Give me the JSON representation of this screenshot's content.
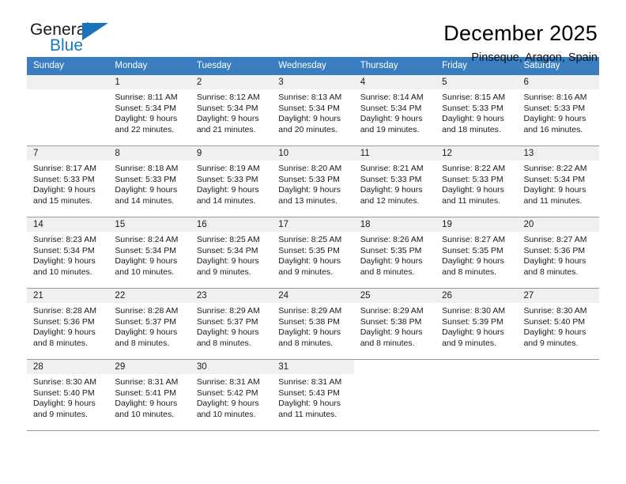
{
  "brand": {
    "name_part1": "General",
    "name_part2": "Blue",
    "triangle_color": "#1b74bb"
  },
  "header": {
    "title": "December 2025",
    "location": "Pinseque, Aragon, Spain"
  },
  "theme": {
    "header_row_bg": "#3a7ebf",
    "day_band_bg": "#f0f0f0",
    "grid_line": "#9a9a9a",
    "brand_blue": "#1878be"
  },
  "weekday_headers": [
    "Sunday",
    "Monday",
    "Tuesday",
    "Wednesday",
    "Thursday",
    "Friday",
    "Saturday"
  ],
  "labels": {
    "sunrise_prefix": "Sunrise:",
    "sunset_prefix": "Sunset:",
    "daylight_prefix": "Daylight:"
  },
  "weeks": [
    [
      {
        "day": "",
        "sunrise": "",
        "sunset": "",
        "daylight_line1": "",
        "daylight_line2": ""
      },
      {
        "day": "1",
        "sunrise": "Sunrise: 8:11 AM",
        "sunset": "Sunset: 5:34 PM",
        "daylight_line1": "Daylight: 9 hours",
        "daylight_line2": "and 22 minutes."
      },
      {
        "day": "2",
        "sunrise": "Sunrise: 8:12 AM",
        "sunset": "Sunset: 5:34 PM",
        "daylight_line1": "Daylight: 9 hours",
        "daylight_line2": "and 21 minutes."
      },
      {
        "day": "3",
        "sunrise": "Sunrise: 8:13 AM",
        "sunset": "Sunset: 5:34 PM",
        "daylight_line1": "Daylight: 9 hours",
        "daylight_line2": "and 20 minutes."
      },
      {
        "day": "4",
        "sunrise": "Sunrise: 8:14 AM",
        "sunset": "Sunset: 5:34 PM",
        "daylight_line1": "Daylight: 9 hours",
        "daylight_line2": "and 19 minutes."
      },
      {
        "day": "5",
        "sunrise": "Sunrise: 8:15 AM",
        "sunset": "Sunset: 5:33 PM",
        "daylight_line1": "Daylight: 9 hours",
        "daylight_line2": "and 18 minutes."
      },
      {
        "day": "6",
        "sunrise": "Sunrise: 8:16 AM",
        "sunset": "Sunset: 5:33 PM",
        "daylight_line1": "Daylight: 9 hours",
        "daylight_line2": "and 16 minutes."
      }
    ],
    [
      {
        "day": "7",
        "sunrise": "Sunrise: 8:17 AM",
        "sunset": "Sunset: 5:33 PM",
        "daylight_line1": "Daylight: 9 hours",
        "daylight_line2": "and 15 minutes."
      },
      {
        "day": "8",
        "sunrise": "Sunrise: 8:18 AM",
        "sunset": "Sunset: 5:33 PM",
        "daylight_line1": "Daylight: 9 hours",
        "daylight_line2": "and 14 minutes."
      },
      {
        "day": "9",
        "sunrise": "Sunrise: 8:19 AM",
        "sunset": "Sunset: 5:33 PM",
        "daylight_line1": "Daylight: 9 hours",
        "daylight_line2": "and 14 minutes."
      },
      {
        "day": "10",
        "sunrise": "Sunrise: 8:20 AM",
        "sunset": "Sunset: 5:33 PM",
        "daylight_line1": "Daylight: 9 hours",
        "daylight_line2": "and 13 minutes."
      },
      {
        "day": "11",
        "sunrise": "Sunrise: 8:21 AM",
        "sunset": "Sunset: 5:33 PM",
        "daylight_line1": "Daylight: 9 hours",
        "daylight_line2": "and 12 minutes."
      },
      {
        "day": "12",
        "sunrise": "Sunrise: 8:22 AM",
        "sunset": "Sunset: 5:33 PM",
        "daylight_line1": "Daylight: 9 hours",
        "daylight_line2": "and 11 minutes."
      },
      {
        "day": "13",
        "sunrise": "Sunrise: 8:22 AM",
        "sunset": "Sunset: 5:34 PM",
        "daylight_line1": "Daylight: 9 hours",
        "daylight_line2": "and 11 minutes."
      }
    ],
    [
      {
        "day": "14",
        "sunrise": "Sunrise: 8:23 AM",
        "sunset": "Sunset: 5:34 PM",
        "daylight_line1": "Daylight: 9 hours",
        "daylight_line2": "and 10 minutes."
      },
      {
        "day": "15",
        "sunrise": "Sunrise: 8:24 AM",
        "sunset": "Sunset: 5:34 PM",
        "daylight_line1": "Daylight: 9 hours",
        "daylight_line2": "and 10 minutes."
      },
      {
        "day": "16",
        "sunrise": "Sunrise: 8:25 AM",
        "sunset": "Sunset: 5:34 PM",
        "daylight_line1": "Daylight: 9 hours",
        "daylight_line2": "and 9 minutes."
      },
      {
        "day": "17",
        "sunrise": "Sunrise: 8:25 AM",
        "sunset": "Sunset: 5:35 PM",
        "daylight_line1": "Daylight: 9 hours",
        "daylight_line2": "and 9 minutes."
      },
      {
        "day": "18",
        "sunrise": "Sunrise: 8:26 AM",
        "sunset": "Sunset: 5:35 PM",
        "daylight_line1": "Daylight: 9 hours",
        "daylight_line2": "and 8 minutes."
      },
      {
        "day": "19",
        "sunrise": "Sunrise: 8:27 AM",
        "sunset": "Sunset: 5:35 PM",
        "daylight_line1": "Daylight: 9 hours",
        "daylight_line2": "and 8 minutes."
      },
      {
        "day": "20",
        "sunrise": "Sunrise: 8:27 AM",
        "sunset": "Sunset: 5:36 PM",
        "daylight_line1": "Daylight: 9 hours",
        "daylight_line2": "and 8 minutes."
      }
    ],
    [
      {
        "day": "21",
        "sunrise": "Sunrise: 8:28 AM",
        "sunset": "Sunset: 5:36 PM",
        "daylight_line1": "Daylight: 9 hours",
        "daylight_line2": "and 8 minutes."
      },
      {
        "day": "22",
        "sunrise": "Sunrise: 8:28 AM",
        "sunset": "Sunset: 5:37 PM",
        "daylight_line1": "Daylight: 9 hours",
        "daylight_line2": "and 8 minutes."
      },
      {
        "day": "23",
        "sunrise": "Sunrise: 8:29 AM",
        "sunset": "Sunset: 5:37 PM",
        "daylight_line1": "Daylight: 9 hours",
        "daylight_line2": "and 8 minutes."
      },
      {
        "day": "24",
        "sunrise": "Sunrise: 8:29 AM",
        "sunset": "Sunset: 5:38 PM",
        "daylight_line1": "Daylight: 9 hours",
        "daylight_line2": "and 8 minutes."
      },
      {
        "day": "25",
        "sunrise": "Sunrise: 8:29 AM",
        "sunset": "Sunset: 5:38 PM",
        "daylight_line1": "Daylight: 9 hours",
        "daylight_line2": "and 8 minutes."
      },
      {
        "day": "26",
        "sunrise": "Sunrise: 8:30 AM",
        "sunset": "Sunset: 5:39 PM",
        "daylight_line1": "Daylight: 9 hours",
        "daylight_line2": "and 9 minutes."
      },
      {
        "day": "27",
        "sunrise": "Sunrise: 8:30 AM",
        "sunset": "Sunset: 5:40 PM",
        "daylight_line1": "Daylight: 9 hours",
        "daylight_line2": "and 9 minutes."
      }
    ],
    [
      {
        "day": "28",
        "sunrise": "Sunrise: 8:30 AM",
        "sunset": "Sunset: 5:40 PM",
        "daylight_line1": "Daylight: 9 hours",
        "daylight_line2": "and 9 minutes."
      },
      {
        "day": "29",
        "sunrise": "Sunrise: 8:31 AM",
        "sunset": "Sunset: 5:41 PM",
        "daylight_line1": "Daylight: 9 hours",
        "daylight_line2": "and 10 minutes."
      },
      {
        "day": "30",
        "sunrise": "Sunrise: 8:31 AM",
        "sunset": "Sunset: 5:42 PM",
        "daylight_line1": "Daylight: 9 hours",
        "daylight_line2": "and 10 minutes."
      },
      {
        "day": "31",
        "sunrise": "Sunrise: 8:31 AM",
        "sunset": "Sunset: 5:43 PM",
        "daylight_line1": "Daylight: 9 hours",
        "daylight_line2": "and 11 minutes."
      },
      {
        "day": "",
        "sunrise": "",
        "sunset": "",
        "daylight_line1": "",
        "daylight_line2": ""
      },
      {
        "day": "",
        "sunrise": "",
        "sunset": "",
        "daylight_line1": "",
        "daylight_line2": ""
      },
      {
        "day": "",
        "sunrise": "",
        "sunset": "",
        "daylight_line1": "",
        "daylight_line2": ""
      }
    ]
  ]
}
